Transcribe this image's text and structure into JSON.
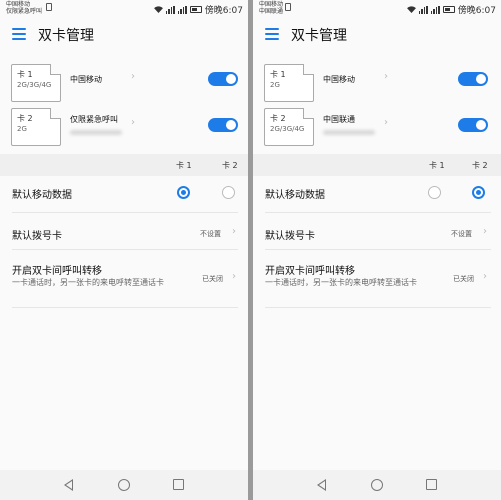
{
  "left": {
    "status": {
      "carrier1": "中国移动",
      "carrier2": "仅限紧急呼叫",
      "time": "傍晚6:07"
    },
    "title": "双卡管理",
    "sims": [
      {
        "slot": "卡 1",
        "types": "2G/3G/4G",
        "operator": "中国移动",
        "enabled": true
      },
      {
        "slot": "卡 2",
        "types": "2G",
        "operator": "仅限紧急呼叫",
        "enabled": true
      }
    ],
    "columns": {
      "card1": "卡 1",
      "card2": "卡 2"
    },
    "default_data": {
      "label": "默认移动数据",
      "selected": "card1"
    },
    "default_dial": {
      "label": "默认拨号卡",
      "value": "不设置"
    },
    "call_forward": {
      "label": "开启双卡间呼叫转移",
      "desc": "一卡通话时，另一张卡的来电呼转至通话卡",
      "value": "已关闭"
    }
  },
  "right": {
    "status": {
      "carrier1": "中国移动",
      "carrier2": "中国联通",
      "time": "傍晚6:07"
    },
    "title": "双卡管理",
    "sims": [
      {
        "slot": "卡 1",
        "types": "2G",
        "operator": "中国移动",
        "enabled": true
      },
      {
        "slot": "卡 2",
        "types": "2G/3G/4G",
        "operator": "中国联通",
        "enabled": true
      }
    ],
    "columns": {
      "card1": "卡 1",
      "card2": "卡 2"
    },
    "default_data": {
      "label": "默认移动数据",
      "selected": "card2"
    },
    "default_dial": {
      "label": "默认拨号卡",
      "value": "不设置"
    },
    "call_forward": {
      "label": "开启双卡间呼叫转移",
      "desc": "一卡通话时，另一张卡的来电呼转至通话卡",
      "value": "已关闭"
    }
  },
  "colors": {
    "accent": "#1e7ce8",
    "background": "#fafafa",
    "band": "#efefef"
  }
}
